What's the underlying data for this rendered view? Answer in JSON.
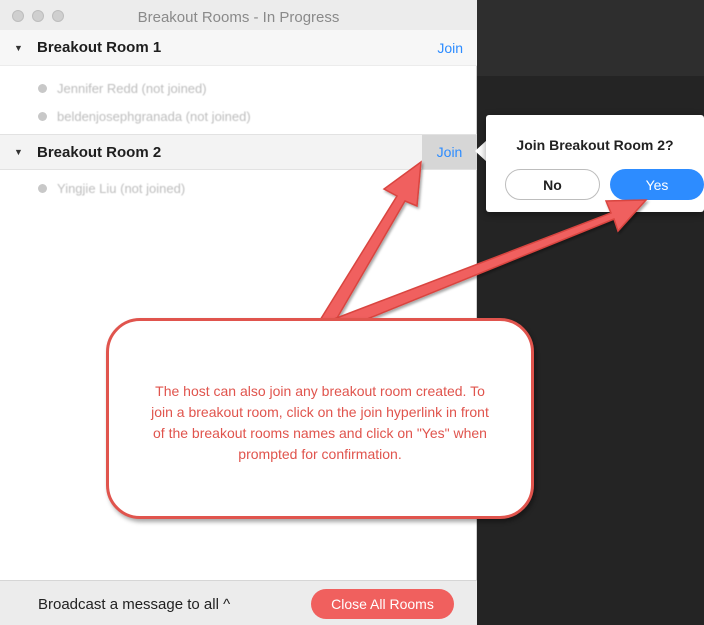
{
  "window": {
    "title": "Breakout Rooms - In Progress"
  },
  "rooms": [
    {
      "name": "Breakout Room 1",
      "join_label": "Join",
      "members": [
        "Jennifer Redd (not joined)",
        "beldenjosephgranada (not joined)"
      ]
    },
    {
      "name": "Breakout Room 2",
      "join_label": "Join",
      "members": [
        "Yingjie Liu (not joined)"
      ]
    }
  ],
  "footer": {
    "broadcast_label": "Broadcast a message to all ^",
    "close_all_label": "Close All Rooms"
  },
  "popup": {
    "title": "Join Breakout Room 2?",
    "no_label": "No",
    "yes_label": "Yes"
  },
  "callout": {
    "text": "The host can also join any breakout room created. To join a breakout room, click on the join hyperlink in front of the breakout rooms names and click on \"Yes\" when prompted for confirmation."
  },
  "colors": {
    "accent": "#2d8cff",
    "close_button": "#f0605e",
    "annotation": "#e0544d"
  }
}
